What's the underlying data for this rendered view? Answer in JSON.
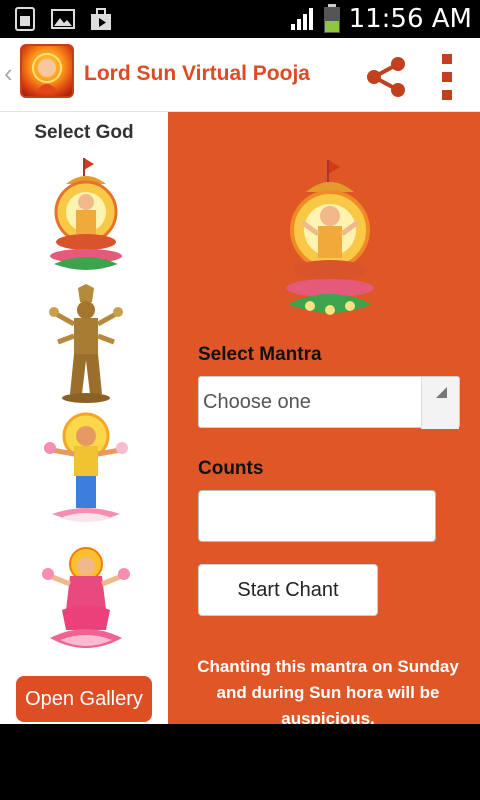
{
  "status_bar": {
    "time": "11:56 AM",
    "icons": [
      "sim-icon",
      "image-icon",
      "media-icon",
      "signal-icon",
      "battery-icon"
    ]
  },
  "action_bar": {
    "title": "Lord Sun Virtual Pooja",
    "icons": [
      "app-icon",
      "share-icon",
      "overflow-menu-icon"
    ]
  },
  "left_panel": {
    "heading": "Select God",
    "gods": [
      "god-sun-thumbnail",
      "god-vishnu-thumbnail",
      "god-krishna-thumbnail",
      "god-lakshmi-thumbnail"
    ],
    "open_gallery_label": "Open Gallery"
  },
  "main": {
    "select_mantra_label": "Select Mantra",
    "mantra_select_value": "Choose one",
    "counts_label": "Counts",
    "counts_value": "",
    "start_button_label": "Start Chant",
    "note": "Chanting this mantra on Sunday and during Sun hora will be auspicious."
  },
  "colors": {
    "accent": "#df5627",
    "title": "#dd4b23",
    "button": "#dd4e25"
  }
}
